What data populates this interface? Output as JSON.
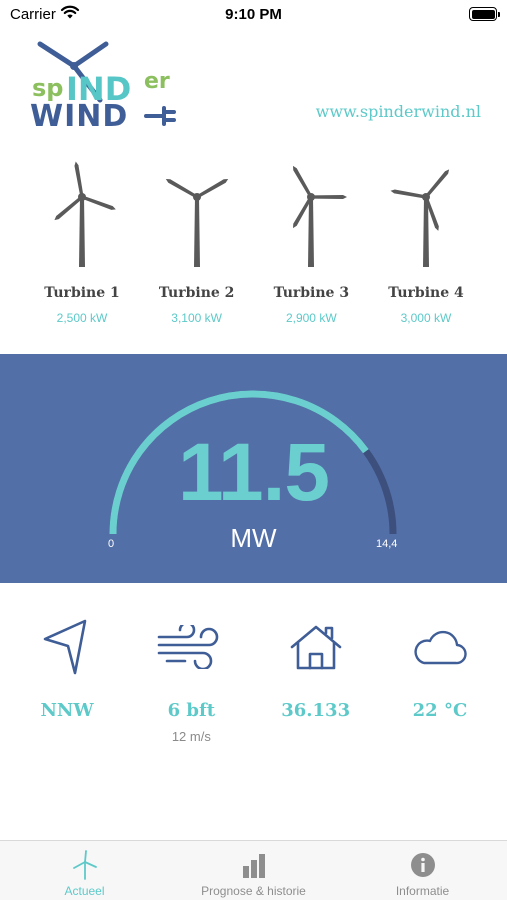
{
  "status_bar": {
    "carrier": "Carrier",
    "time": "9:10 PM",
    "battery_level": 1.0
  },
  "header": {
    "logo_line1_pre": "sp",
    "logo_line1_mid": "IND",
    "logo_line1_post": "er",
    "logo_line2": "WIND",
    "website": "www.spinderwind.nl"
  },
  "turbines": [
    {
      "name": "Turbine 1",
      "power": "2,500 kW"
    },
    {
      "name": "Turbine 2",
      "power": "3,100 kW"
    },
    {
      "name": "Turbine 3",
      "power": "2,900 kW"
    },
    {
      "name": "Turbine 4",
      "power": "3,000 kW"
    }
  ],
  "gauge": {
    "value": "11.5",
    "unit": "MW",
    "min": "0",
    "max": "14,4",
    "current": 11.5,
    "max_value": 14.4
  },
  "conditions": {
    "direction": "NNW",
    "wind_force": "6 bft",
    "wind_speed": "12 m/s",
    "households": "36.133",
    "temperature": "22 °C"
  },
  "tab_bar": {
    "tabs": [
      {
        "label": "Actueel",
        "icon": "turbine-icon",
        "active": true
      },
      {
        "label": "Prognose & historie",
        "icon": "bar-chart-icon",
        "active": false
      },
      {
        "label": "Informatie",
        "icon": "info-icon",
        "active": false
      }
    ]
  },
  "colors": {
    "accent": "#5dc9c9",
    "panel": "#536fa8",
    "gauge_track": "#3d4f7c",
    "turbine_gray": "#5a5a5a",
    "icon_navy": "#3f5d96"
  }
}
